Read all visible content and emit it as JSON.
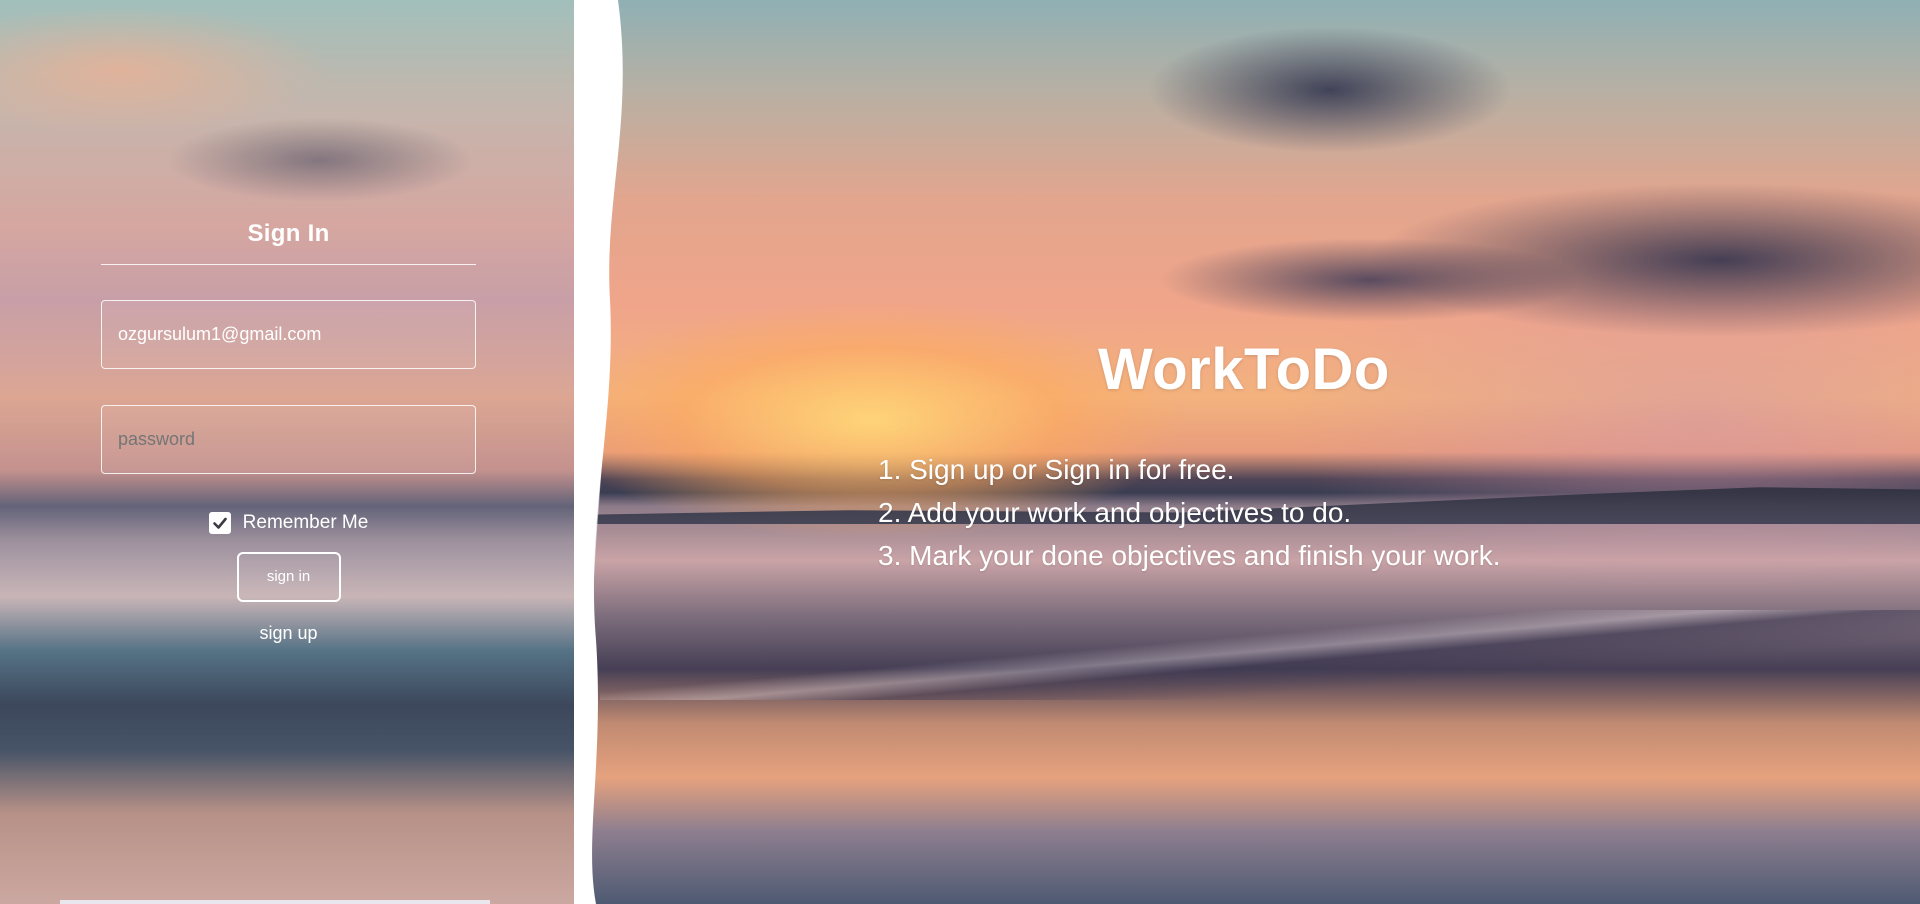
{
  "signin": {
    "title": "Sign In",
    "email_value": "ozgursulum1@gmail.com",
    "password_placeholder": "password",
    "remember_label": "Remember Me",
    "remember_checked": true,
    "signin_button": "sign in",
    "signup_link": "sign up"
  },
  "hero": {
    "brand": "WorkToDo",
    "steps": [
      "1. Sign up or Sign in for free.",
      "2. Add your work and objectives to do.",
      "3. Mark your done objectives and finish your work."
    ]
  },
  "colors": {
    "text": "#ffffff",
    "divider": "#ffffff"
  }
}
